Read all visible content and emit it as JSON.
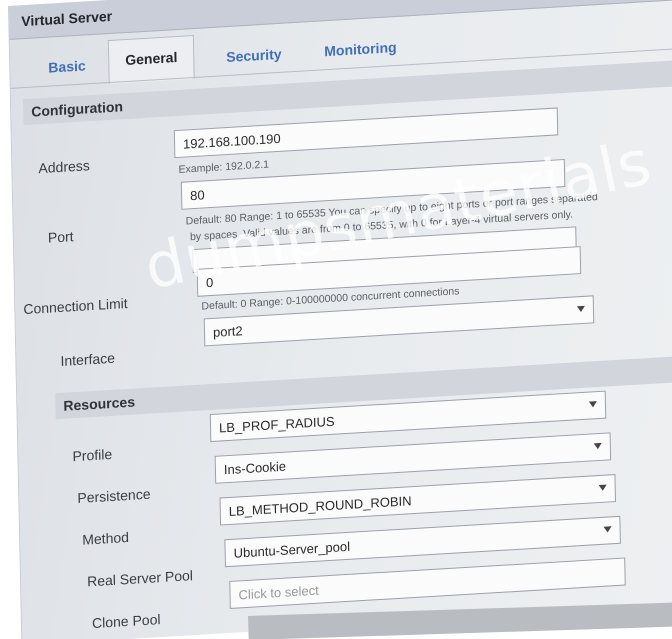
{
  "window": {
    "title": "Virtual Server"
  },
  "tabs": [
    {
      "label": "Basic"
    },
    {
      "label": "General"
    },
    {
      "label": "Security"
    },
    {
      "label": "Monitoring"
    }
  ],
  "configuration": {
    "heading": "Configuration",
    "address": {
      "label": "Address",
      "value": "192.168.100.190",
      "hint": "Example: 192.0.2.1"
    },
    "port": {
      "label": "Port",
      "value": "80",
      "hint_1": "Default: 80 Range: 1 to 65535 You can specify up to eight ports or port ranges separated",
      "hint_2": "by spaces. Valid values are from 0 to 65535, with 0 for Layer-4 virtual servers only."
    },
    "connection_limit": {
      "label": "Connection Limit",
      "value": "0",
      "hint": "Default: 0 Range: 0-100000000 concurrent connections"
    },
    "interface": {
      "label": "Interface",
      "value": "port2"
    }
  },
  "resources": {
    "heading": "Resources",
    "profile": {
      "label": "Profile",
      "value": "LB_PROF_RADIUS"
    },
    "persistence": {
      "label": "Persistence",
      "value": "Ins-Cookie"
    },
    "method": {
      "label": "Method",
      "value": "LB_METHOD_ROUND_ROBIN"
    },
    "real_server_pool": {
      "label": "Real Server Pool",
      "value": "Ubuntu-Server_pool"
    },
    "clone_pool": {
      "label": "Clone Pool",
      "placeholder": "Click to select"
    }
  },
  "overlay": {
    "watermark": "dumpsmaterials"
  },
  "icons": {
    "dropdown": "chevron-down-icon"
  },
  "colors": {
    "tab_link": "#3f6fb5",
    "title_bar": "#c9ced8",
    "section_header": "#d2d6dc"
  }
}
